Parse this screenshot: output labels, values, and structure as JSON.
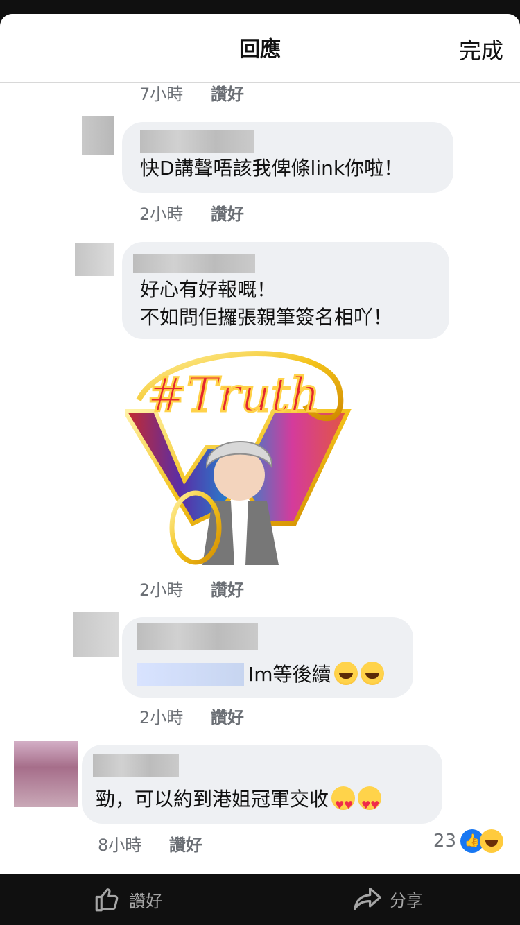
{
  "header": {
    "title": "回應",
    "done": "完成"
  },
  "comments": [
    {
      "time": "7小時",
      "like": "讚好"
    },
    {
      "text": "快D講聲唔該我俾條link你啦！",
      "time": "2小時",
      "like": "讚好"
    },
    {
      "line1": "好心有好報嘅！",
      "line2": "不如問佢攞張親筆簽名相吖！",
      "sticker_text": "#Truth",
      "time": "2小時",
      "like": "讚好"
    },
    {
      "text_visible": "Im等後續",
      "time": "2小時",
      "like": "讚好"
    },
    {
      "text": "勁，可以約到港姐冠軍交收",
      "time": "8小時",
      "like": "讚好",
      "reaction_count": "23"
    }
  ],
  "footer": {
    "like": "讚好",
    "share": "分享"
  },
  "colors": {
    "bubble": "#eef0f3",
    "meta": "#6b6f75",
    "like_blue": "#1877f2"
  }
}
